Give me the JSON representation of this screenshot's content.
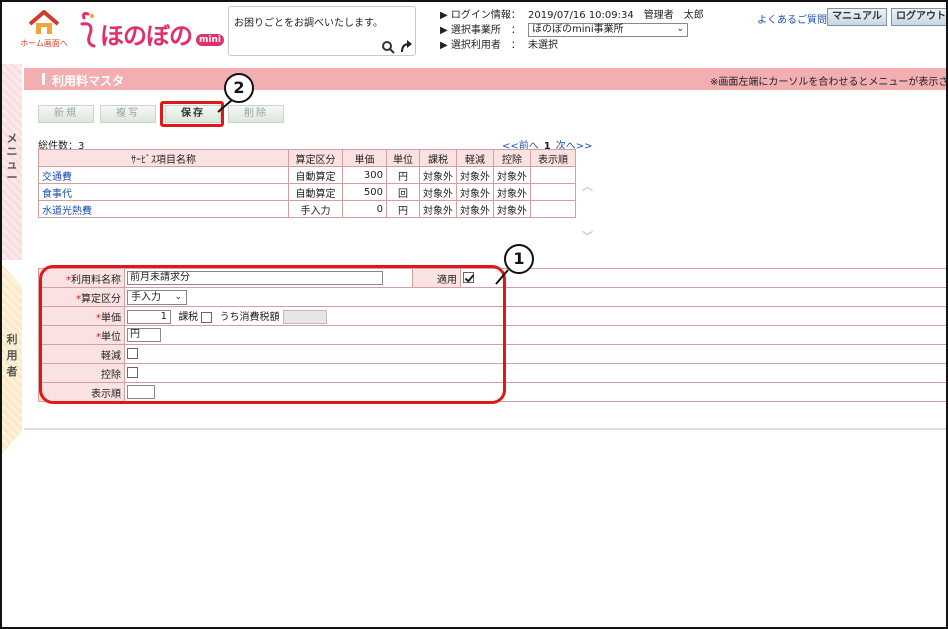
{
  "header": {
    "home_label": "ホーム画面へ",
    "logo_text": "ほのぼの",
    "logo_mini": "mini",
    "search_text": "お困りごとをお調べいたします。",
    "login": {
      "login_label": "ログイン情報：",
      "login_value": "2019/07/16 10:09:34　管理者　太郎",
      "office_label": "選択事業所　：",
      "office_value": "ほのぼのmini事業所",
      "user_label": "選択利用者　：",
      "user_value": "未選択"
    },
    "faq": "よくあるご質問",
    "manual": "マニュアル",
    "logout": "ログアウト"
  },
  "side": {
    "menu_label": "メニュー",
    "user_label": "利用者"
  },
  "title_bar": {
    "title": "利用料マスタ",
    "hint": "※画面左端にカーソルを合わせるとメニューが表示され"
  },
  "toolbar": {
    "new": "新規",
    "copy": "複写",
    "save": "保存",
    "delete": "削除"
  },
  "callouts": {
    "one": "1",
    "two": "2"
  },
  "list": {
    "total": "総件数：3",
    "pager_prev": "<<前へ",
    "pager_page": "1",
    "pager_next": "次へ>>",
    "columns": [
      "ｻｰﾋﾞｽ項目名称",
      "算定区分",
      "単価",
      "単位",
      "課税",
      "軽減",
      "控除",
      "表示順"
    ],
    "rows": [
      {
        "name": "交通費",
        "calc": "自動算定",
        "price": "300",
        "unit": "円",
        "tax": "対象外",
        "reduce": "対象外",
        "deduct": "対象外",
        "order": ""
      },
      {
        "name": "食事代",
        "calc": "自動算定",
        "price": "500",
        "unit": "回",
        "tax": "対象外",
        "reduce": "対象外",
        "deduct": "対象外",
        "order": ""
      },
      {
        "name": "水道光熱費",
        "calc": "手入力",
        "price": "0",
        "unit": "円",
        "tax": "対象外",
        "reduce": "対象外",
        "deduct": "対象外",
        "order": ""
      }
    ]
  },
  "form": {
    "name_label": "利用料名称",
    "name_value": "前月未請求分",
    "apply_label": "適用",
    "calc_label": "算定区分",
    "calc_value": "手入力",
    "price_label": "単価",
    "price_value": "1",
    "tax_label": "課税",
    "tax_included_label": "うち消費税額",
    "unit_label": "単位",
    "unit_value": "円",
    "reduce_label": "軽減",
    "deduct_label": "控除",
    "order_label": "表示順",
    "required_mark": "*"
  },
  "colors": {
    "accent": "#f2aeb0",
    "highlight": "#e01818",
    "link": "#1a4fb5"
  }
}
